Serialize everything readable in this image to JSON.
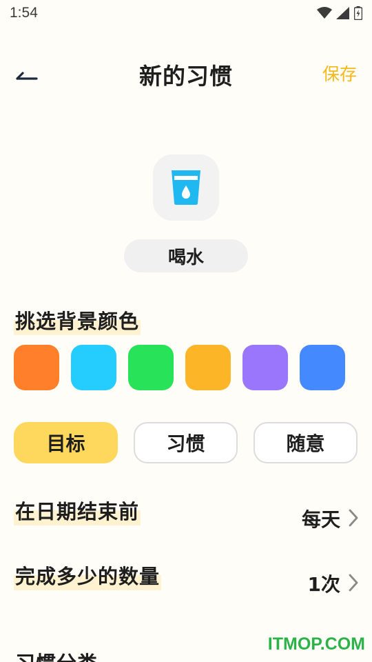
{
  "status_bar": {
    "time": "1:54"
  },
  "header": {
    "title": "新的习惯",
    "save_label": "保存"
  },
  "habit": {
    "icon": "water-cup-icon",
    "name": "喝水"
  },
  "color_section": {
    "label": "挑选背景颜色",
    "colors": [
      "#ff7f2a",
      "#24cdfd",
      "#28e25a",
      "#fdb528",
      "#9a76fd",
      "#4589fe"
    ]
  },
  "tabs": [
    {
      "label": "目标",
      "active": true
    },
    {
      "label": "习惯",
      "active": false
    },
    {
      "label": "随意",
      "active": false
    }
  ],
  "settings": [
    {
      "label": "在日期结束前",
      "value": "每天"
    },
    {
      "label": "完成多少的数量",
      "value": "1次"
    }
  ],
  "partial_section": {
    "label": "习惯分类"
  },
  "watermark": "ITMOP.COM",
  "accent_colors": {
    "save": "#f4b81a",
    "tab_active": "#fed75d",
    "label_highlight": "#fff2d1"
  }
}
